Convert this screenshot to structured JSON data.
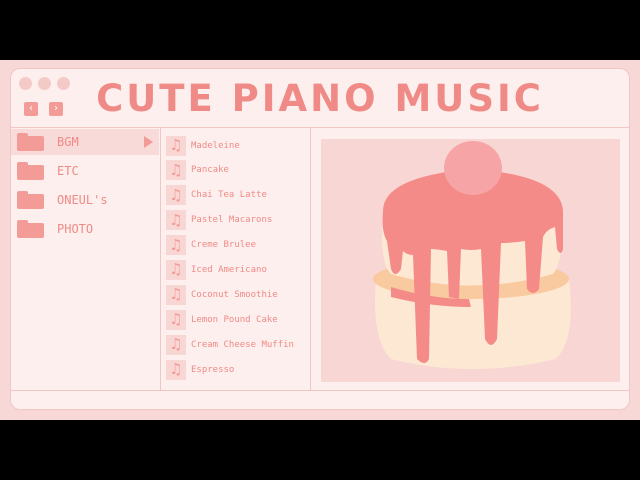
{
  "window": {
    "title": "CUTE PIANO MUSIC",
    "back_label": "‹",
    "forward_label": "›"
  },
  "sidebar": {
    "items": [
      {
        "label": "BGM",
        "active": true
      },
      {
        "label": "ETC"
      },
      {
        "label": "ONEUL's"
      },
      {
        "label": "PHOTO"
      }
    ]
  },
  "songs": [
    "Madeleine",
    "Pancake",
    "Chai Tea Latte",
    "Pastel Macarons",
    "Creme Brulee",
    "Iced Americano",
    "Coconut Smoothie",
    "Lemon Pound Cake",
    "Cream Cheese Muffin",
    "Espresso"
  ],
  "icons": {
    "note_glyph": "♫"
  },
  "colors": {
    "accent": "#f08a86",
    "background": "#fcefee",
    "frame": "#f8d8d6",
    "pancake": "#fde9d3",
    "syrup": "#f48b88",
    "strawberry": "#f6a4a6"
  }
}
